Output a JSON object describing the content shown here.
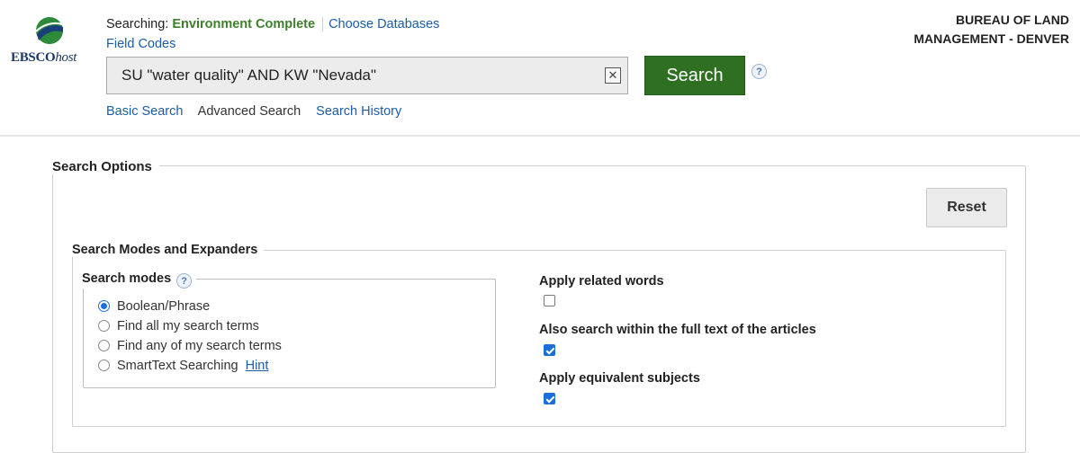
{
  "header": {
    "logo": {
      "brand": "EBSCO",
      "brand_suffix": "host"
    },
    "searching_label": "Searching:",
    "database": "Environment Complete",
    "choose_databases": "Choose Databases",
    "field_codes": "Field Codes",
    "search": {
      "query": "SU \"water quality\" AND KW \"Nevada\"",
      "button_label": "Search",
      "help_glyph": "?"
    },
    "links": [
      {
        "label": "Basic Search",
        "active": false
      },
      {
        "label": "Advanced Search",
        "active": true
      },
      {
        "label": "Search History",
        "active": false
      }
    ],
    "institution_line1": "BUREAU OF LAND",
    "institution_line2": "MANAGEMENT - DENVER"
  },
  "options": {
    "title": "Search Options",
    "reset_label": "Reset",
    "section_title": "Search Modes and Expanders",
    "modes": {
      "label": "Search modes",
      "items": [
        {
          "label": "Boolean/Phrase",
          "selected": true
        },
        {
          "label": "Find all my search terms",
          "selected": false
        },
        {
          "label": "Find any of my search terms",
          "selected": false
        },
        {
          "label": "SmartText Searching",
          "selected": false
        }
      ],
      "hint_label": "Hint"
    },
    "expanders": [
      {
        "label": "Apply related words",
        "checked": false
      },
      {
        "label": "Also search within the full text of the articles",
        "checked": true
      },
      {
        "label": "Apply equivalent subjects",
        "checked": true
      }
    ]
  },
  "colors": {
    "search_button": "#2f6f22",
    "database_name": "#3d7f2a",
    "link": "#1a5da6",
    "checkbox_accent": "#1a6fdc"
  }
}
